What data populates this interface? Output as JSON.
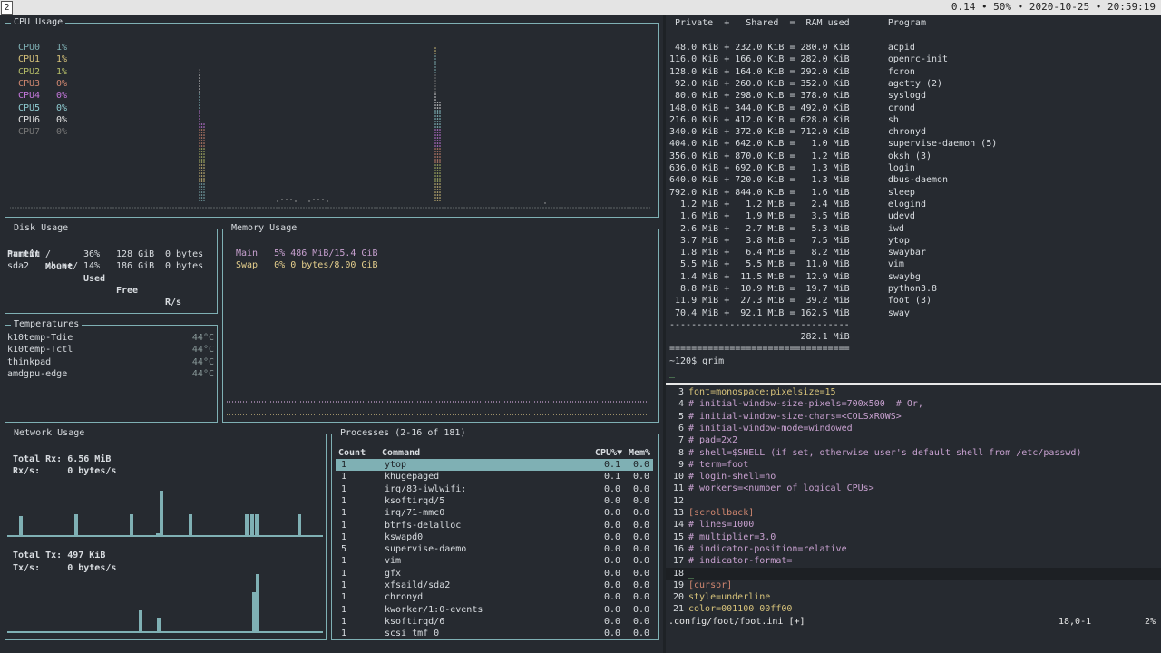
{
  "topbar": {
    "workspace": "2",
    "status": "0.14 • 50% • 2020-10-25 • 20:59:19"
  },
  "colors": {
    "border": "#7fb0b4",
    "cpu": [
      "#7fb0b4",
      "#d6c27a",
      "#b5bd68",
      "#d08770",
      "#c678dd",
      "#8ecbd1",
      "#e0e0e0",
      "#777777"
    ],
    "mem_main": "#c7a0cf",
    "mem_swap": "#e5cf8d",
    "vim_comment": "#c7a0cf",
    "vim_section": "#d08770",
    "vim_key": "#d6c27a"
  },
  "cpu": {
    "title": "CPU Usage",
    "cores": [
      {
        "label": "CPU0",
        "value": "1%"
      },
      {
        "label": "CPU1",
        "value": "1%"
      },
      {
        "label": "CPU2",
        "value": "1%"
      },
      {
        "label": "CPU3",
        "value": "0%"
      },
      {
        "label": "CPU4",
        "value": "0%"
      },
      {
        "label": "CPU5",
        "value": "0%"
      },
      {
        "label": "CPU6",
        "value": "0%"
      },
      {
        "label": "CPU7",
        "value": "0%"
      }
    ]
  },
  "disk": {
    "title": "Disk Usage",
    "headers": [
      "Partit",
      "Mount",
      "Used",
      "Free",
      "R/s"
    ],
    "rows": [
      [
        "nvme0n",
        "/",
        "36%",
        "128 GiB",
        "0 bytes"
      ],
      [
        "sda2",
        "/home/",
        "14%",
        "186 GiB",
        "0 bytes"
      ]
    ]
  },
  "memory": {
    "title": "Memory Usage",
    "main": "Main   5% 486 MiB/15.4 GiB",
    "swap": "Swap   0% 0 bytes/8.00 GiB"
  },
  "temps": {
    "title": "Temperatures",
    "rows": [
      {
        "name": "k10temp-Tdie",
        "value": "44°C"
      },
      {
        "name": "k10temp-Tctl",
        "value": "44°C"
      },
      {
        "name": "thinkpad",
        "value": "44°C"
      },
      {
        "name": "amdgpu-edge",
        "value": "44°C"
      }
    ]
  },
  "network": {
    "title": "Network Usage",
    "rx_total": "Total Rx: 6.56 MiB",
    "rx_rate": "Rx/s:     0 bytes/s",
    "tx_total": "Total Tx: 497 KiB",
    "tx_rate": "Tx/s:     0 bytes/s"
  },
  "processes": {
    "title": "Processes (2-16 of 181)",
    "headers": {
      "count": "Count",
      "command": "Command",
      "cpu": "CPU%▼",
      "mem": "Mem%"
    },
    "rows": [
      {
        "count": "1",
        "command": "ytop",
        "cpu": "0.1",
        "mem": "0.0"
      },
      {
        "count": "1",
        "command": "khugepaged",
        "cpu": "0.1",
        "mem": "0.0"
      },
      {
        "count": "1",
        "command": "irq/83-iwlwifi:",
        "cpu": "0.0",
        "mem": "0.0"
      },
      {
        "count": "1",
        "command": "ksoftirqd/5",
        "cpu": "0.0",
        "mem": "0.0"
      },
      {
        "count": "1",
        "command": "irq/71-mmc0",
        "cpu": "0.0",
        "mem": "0.0"
      },
      {
        "count": "1",
        "command": "btrfs-delalloc",
        "cpu": "0.0",
        "mem": "0.0"
      },
      {
        "count": "1",
        "command": "kswapd0",
        "cpu": "0.0",
        "mem": "0.0"
      },
      {
        "count": "5",
        "command": "supervise-daemo",
        "cpu": "0.0",
        "mem": "0.0"
      },
      {
        "count": "1",
        "command": "vim",
        "cpu": "0.0",
        "mem": "0.0"
      },
      {
        "count": "1",
        "command": "gfx",
        "cpu": "0.0",
        "mem": "0.0"
      },
      {
        "count": "1",
        "command": "xfsaild/sda2",
        "cpu": "0.0",
        "mem": "0.0"
      },
      {
        "count": "1",
        "command": "chronyd",
        "cpu": "0.0",
        "mem": "0.0"
      },
      {
        "count": "1",
        "command": "kworker/1:0-events",
        "cpu": "0.0",
        "mem": "0.0"
      },
      {
        "count": "1",
        "command": "ksoftirqd/6",
        "cpu": "0.0",
        "mem": "0.0"
      },
      {
        "count": "1",
        "command": "scsi_tmf_0",
        "cpu": "0.0",
        "mem": "0.0"
      }
    ]
  },
  "ps_mem": {
    "header": " Private  +   Shared  =  RAM used       Program",
    "rows": [
      " 48.0 KiB + 232.0 KiB = 280.0 KiB       acpid",
      "116.0 KiB + 166.0 KiB = 282.0 KiB       openrc-init",
      "128.0 KiB + 164.0 KiB = 292.0 KiB       fcron",
      " 92.0 KiB + 260.0 KiB = 352.0 KiB       agetty (2)",
      " 80.0 KiB + 298.0 KiB = 378.0 KiB       syslogd",
      "148.0 KiB + 344.0 KiB = 492.0 KiB       crond",
      "216.0 KiB + 412.0 KiB = 628.0 KiB       sh",
      "340.0 KiB + 372.0 KiB = 712.0 KiB       chronyd",
      "404.0 KiB + 642.0 KiB =   1.0 MiB       supervise-daemon (5)",
      "356.0 KiB + 870.0 KiB =   1.2 MiB       oksh (3)",
      "636.0 KiB + 692.0 KiB =   1.3 MiB       login",
      "640.0 KiB + 720.0 KiB =   1.3 MiB       dbus-daemon",
      "792.0 KiB + 844.0 KiB =   1.6 MiB       sleep",
      "  1.2 MiB +   1.2 MiB =   2.4 MiB       elogind",
      "  1.6 MiB +   1.9 MiB =   3.5 MiB       udevd",
      "  2.6 MiB +   2.7 MiB =   5.3 MiB       iwd",
      "  3.7 MiB +   3.8 MiB =   7.5 MiB       ytop",
      "  1.8 MiB +   6.4 MiB =   8.2 MiB       swaybar",
      "  5.5 MiB +   5.5 MiB =  11.0 MiB       vim",
      "  1.4 MiB +  11.5 MiB =  12.9 MiB       swaybg",
      "  8.8 MiB +  10.9 MiB =  19.7 MiB       python3.8",
      " 11.9 MiB +  27.3 MiB =  39.2 MiB       foot (3)",
      " 70.4 MiB +  92.1 MiB = 162.5 MiB       sway"
    ],
    "rule1": "---------------------------------",
    "total": "                        282.1 MiB",
    "rule2": "=================================",
    "prompt": "~120$ grim",
    "cursor": "_"
  },
  "vim": {
    "lines": [
      {
        "n": "3",
        "t": "font=monospace:pixelsize=15",
        "k": "plain"
      },
      {
        "n": "4",
        "t": "# initial-window-size-pixels=700x500  # Or,",
        "k": "comment"
      },
      {
        "n": "5",
        "t": "# initial-window-size-chars=<COLSxROWS>",
        "k": "comment"
      },
      {
        "n": "6",
        "t": "# initial-window-mode=windowed",
        "k": "comment"
      },
      {
        "n": "7",
        "t": "# pad=2x2",
        "k": "comment"
      },
      {
        "n": "8",
        "t": "# shell=$SHELL (if set, otherwise user's default shell from /etc/passwd)",
        "k": "comment"
      },
      {
        "n": "9",
        "t": "# term=foot",
        "k": "comment"
      },
      {
        "n": "10",
        "t": "# login-shell=no",
        "k": "comment"
      },
      {
        "n": "11",
        "t": "# workers=<number of logical CPUs>",
        "k": "comment"
      },
      {
        "n": "12",
        "t": "",
        "k": "plain"
      },
      {
        "n": "13",
        "t": "[scrollback]",
        "k": "section"
      },
      {
        "n": "14",
        "t": "# lines=1000",
        "k": "comment"
      },
      {
        "n": "15",
        "t": "# multiplier=3.0",
        "k": "comment"
      },
      {
        "n": "16",
        "t": "# indicator-position=relative",
        "k": "comment"
      },
      {
        "n": "17",
        "t": "# indicator-format=",
        "k": "comment"
      },
      {
        "n": "18",
        "t": "_",
        "k": "cursor"
      },
      {
        "n": "19",
        "t": "[cursor]",
        "k": "section"
      },
      {
        "n": "20",
        "t": "style=underline",
        "k": "plain"
      },
      {
        "n": "21",
        "t": "color=001100 00ff00",
        "k": "plain"
      }
    ],
    "status_file": ".config/foot/foot.ini [+]",
    "status_pos": "18,0-1",
    "status_pct": "2%"
  }
}
